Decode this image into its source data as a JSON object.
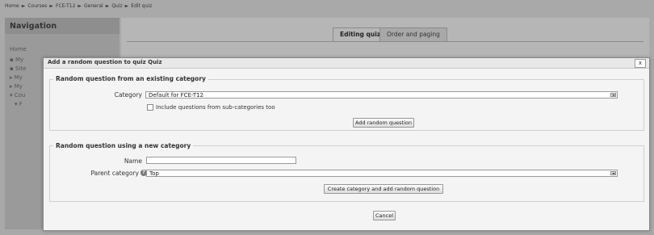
{
  "breadcrumb": {
    "items": [
      "Home",
      "Courses",
      "FCE-T12",
      "General",
      "Quiz",
      "Edit quiz"
    ],
    "separator": "►"
  },
  "navigation": {
    "title": "Navigation",
    "items": [
      "Home",
      "My",
      "Site",
      "My",
      "My",
      "Cou",
      "F"
    ]
  },
  "tabs": [
    {
      "label": "Editing quiz",
      "active": true
    },
    {
      "label": "Order and paging",
      "active": false
    }
  ],
  "dialog": {
    "title": "Add a random question to quiz Quiz",
    "close_label": "x",
    "existing": {
      "legend": "Random question from an existing category",
      "category_label": "Category",
      "category_value": "Default for FCE-T12",
      "subcategories_label": "Include questions from sub-categories too",
      "subcategories_checked": false,
      "add_button": "Add random question"
    },
    "new_category": {
      "legend": "Random question using a new category",
      "name_label": "Name",
      "name_value": "",
      "parent_label": "Parent category",
      "parent_value": "Top",
      "create_button": "Create category and add random question"
    },
    "cancel_button": "Cancel"
  },
  "colors": {
    "overlay": "#a9a9a9",
    "dialog_bg": "#f4f4f4",
    "border": "#cfcfcf"
  }
}
